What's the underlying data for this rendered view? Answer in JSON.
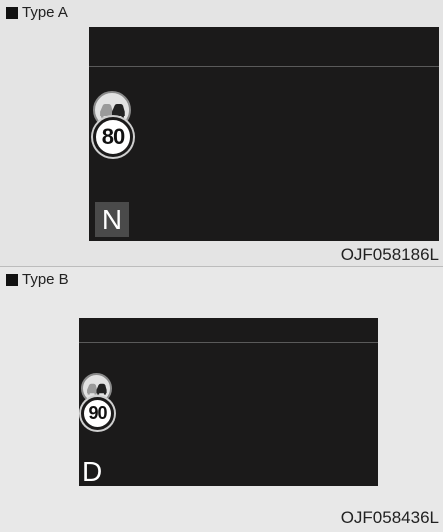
{
  "type_a": {
    "label": "Type A",
    "code": "OJF058186L",
    "speed_limit": "80",
    "gear": "N",
    "icon": "no-overtaking-sign-icon"
  },
  "type_b": {
    "label": "Type B",
    "code": "OJF058436L",
    "speed_limit": "90",
    "gear": "D",
    "icon": "no-overtaking-sign-icon"
  }
}
